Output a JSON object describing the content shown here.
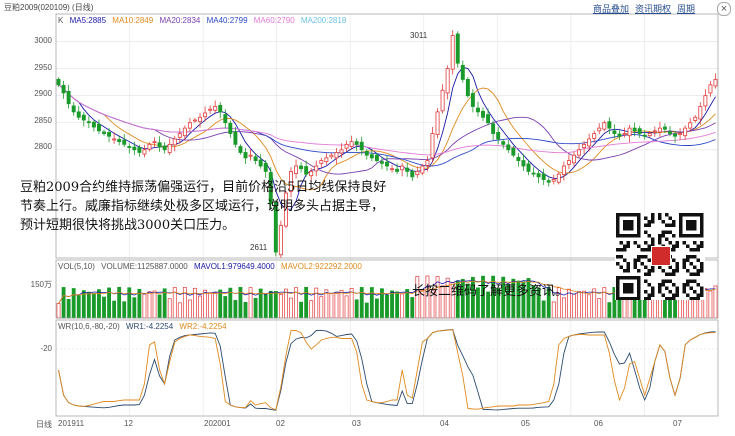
{
  "window": {
    "title": "豆粕2009(020109) (日线)",
    "buttons": [
      {
        "label": "商品叠加"
      },
      {
        "label": "资讯期权"
      },
      {
        "label": "周期"
      }
    ],
    "close_symbol": "×"
  },
  "price_panel": {
    "k_label": "K",
    "ma_legend": [
      {
        "label": "MA5:2885",
        "color": "#1a1aa6"
      },
      {
        "label": "MA10:2849",
        "color": "#e08a1e"
      },
      {
        "label": "MA20:2834",
        "color": "#7a3fb0"
      },
      {
        "label": "MA40:2799",
        "color": "#2c48c8"
      },
      {
        "label": "MA60:2790",
        "color": "#e27bd8"
      },
      {
        "label": "MA200:2818",
        "color": "#6fc3e0"
      }
    ],
    "y_ticks": [
      "3000",
      "2950",
      "2900",
      "2850",
      "2800"
    ],
    "high_label": "3011",
    "low_label": "2611"
  },
  "volume_panel": {
    "legend": [
      {
        "label": "VOL(5,10)",
        "color": "#555555"
      },
      {
        "label": "VOLUME:1125887.0000",
        "color": "#555555"
      },
      {
        "label": "MAVOL1:979649.4000",
        "color": "#1a1aa6"
      },
      {
        "label": "MAVOL2:922292.2000",
        "color": "#e08a1e"
      }
    ],
    "y_tick": "150万"
  },
  "wr_panel": {
    "legend": [
      {
        "label": "WR(10,6,-80,-20)",
        "color": "#555555"
      },
      {
        "label": "WR1:-4.2254",
        "color": "#2c4a6e"
      },
      {
        "label": "WR2:-4.2254",
        "color": "#e08a1e"
      }
    ],
    "y_tick": "-20"
  },
  "x_axis": {
    "period_label": "日线",
    "labels": [
      "201911",
      "12",
      "202001",
      "02",
      "03",
      "04",
      "05",
      "06",
      "07"
    ]
  },
  "annotation": "豆粕2009合约维持振荡偏强运行，目前价格沿5日均线保持良好节奏上行。威廉指标继续处极多区域运行，说明多头占据主导，预计短期很快将挑战3000关口压力。",
  "cta": "长按二维码了解更多资讯。",
  "colors": {
    "up": "#e23b3b",
    "down": "#1a9a2a",
    "grid": "#e6e6e6",
    "axis": "#9a9a9a"
  },
  "chart_data": {
    "type": "candlestick",
    "y_range": [
      2600,
      3025
    ],
    "close_series": [
      2920,
      2905,
      2885,
      2870,
      2860,
      2855,
      2850,
      2842,
      2835,
      2830,
      2825,
      2820,
      2815,
      2810,
      2805,
      2800,
      2795,
      2800,
      2810,
      2815,
      2805,
      2800,
      2810,
      2820,
      2830,
      2840,
      2850,
      2855,
      2860,
      2868,
      2875,
      2880,
      2870,
      2850,
      2830,
      2810,
      2795,
      2785,
      2790,
      2780,
      2770,
      2760,
      2700,
      2611,
      2660,
      2720,
      2760,
      2770,
      2765,
      2755,
      2760,
      2770,
      2780,
      2785,
      2790,
      2795,
      2800,
      2810,
      2815,
      2810,
      2800,
      2790,
      2785,
      2780,
      2775,
      2770,
      2765,
      2760,
      2770,
      2760,
      2750,
      2760,
      2770,
      2780,
      2830,
      2870,
      2910,
      2950,
      3011,
      2960,
      2930,
      2900,
      2880,
      2870,
      2860,
      2850,
      2830,
      2820,
      2810,
      2800,
      2790,
      2780,
      2770,
      2760,
      2755,
      2750,
      2745,
      2740,
      2745,
      2755,
      2770,
      2780,
      2790,
      2800,
      2810,
      2820,
      2830,
      2840,
      2850,
      2840,
      2830,
      2825,
      2830,
      2840,
      2835,
      2830,
      2825,
      2830,
      2835,
      2840,
      2838,
      2830,
      2825,
      2830,
      2840,
      2850,
      2860,
      2880,
      2900,
      2920,
      2930
    ],
    "ma_values": {
      "MA5": 2885,
      "MA10": 2849,
      "MA20": 2834,
      "MA40": 2799,
      "MA60": 2790,
      "MA200": 2818
    },
    "volume": {
      "VOLUME": 1125887.0,
      "MAVOL1": 979649.4,
      "MAVOL2": 922292.2
    },
    "wr": {
      "WR1": -4.2254,
      "WR2": -4.2254
    }
  }
}
